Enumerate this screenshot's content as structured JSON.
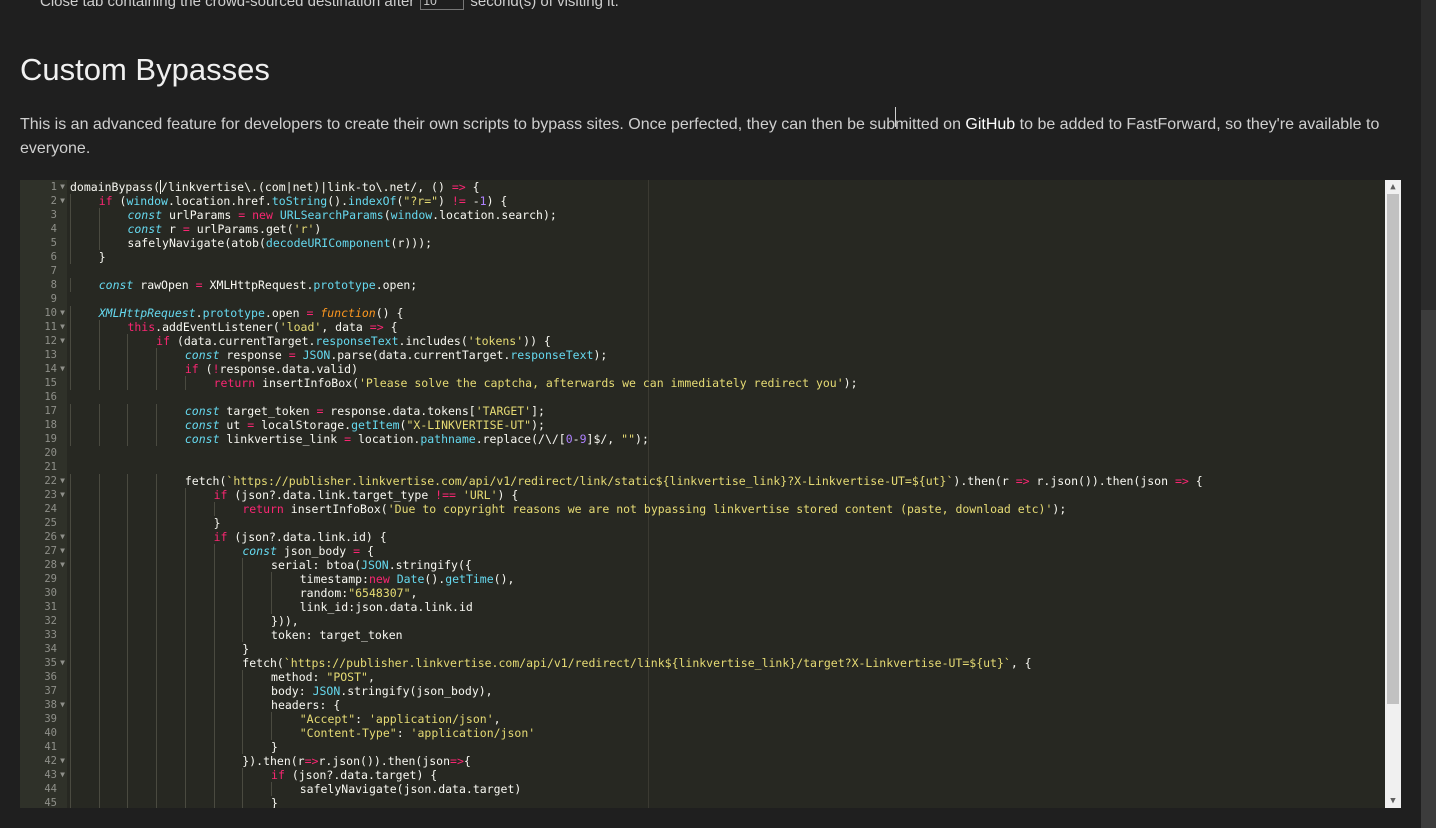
{
  "top_setting": {
    "prefix": "Close tab containing the crowd-sourced destination after",
    "value": "10",
    "suffix": "second(s) of visiting it."
  },
  "section": {
    "title": "Custom Bypasses",
    "desc_before": "This is an advanced feature for developers to create their own scripts to bypass sites. Once perfected, they can then be submitted on ",
    "link": "GitHub",
    "desc_after": " to be added to FastForward, so they're available to everyone."
  },
  "editor": {
    "line_numbers": [
      "1",
      "2",
      "3",
      "4",
      "5",
      "6",
      "7",
      "8",
      "9",
      "10",
      "11",
      "12",
      "13",
      "14",
      "15",
      "16",
      "17",
      "18",
      "19",
      "20",
      "21",
      "22",
      "23",
      "24",
      "25",
      "26",
      "27",
      "28",
      "29",
      "30",
      "31",
      "32",
      "33",
      "34",
      "35",
      "36",
      "37",
      "38",
      "39",
      "40",
      "41",
      "42",
      "43",
      "44",
      "45"
    ],
    "fold_lines": [
      1,
      2,
      10,
      11,
      12,
      14,
      22,
      23,
      26,
      27,
      28,
      35,
      38,
      42,
      43
    ],
    "code_lines": [
      "domainBypass(/linkvertise\\.(com|net)|link-to\\.net/, () => {",
      "    if (window.location.href.toString().indexOf(\"?r=\") != -1) {",
      "        const urlParams = new URLSearchParams(window.location.search);",
      "        const r = urlParams.get('r')",
      "        safelyNavigate(atob(decodeURIComponent(r)));",
      "    }",
      "",
      "    const rawOpen = XMLHttpRequest.prototype.open;",
      "",
      "    XMLHttpRequest.prototype.open = function() {",
      "        this.addEventListener('load', data => {",
      "            if (data.currentTarget.responseText.includes('tokens')) {",
      "                const response = JSON.parse(data.currentTarget.responseText);",
      "                if (!response.data.valid)",
      "                    return insertInfoBox('Please solve the captcha, afterwards we can immediately redirect you');",
      "",
      "                const target_token = response.data.tokens['TARGET'];",
      "                const ut = localStorage.getItem(\"X-LINKVERTISE-UT\");",
      "                const linkvertise_link = location.pathname.replace(/\\/[0-9]$/, \"\");",
      "",
      "",
      "                fetch(`https://publisher.linkvertise.com/api/v1/redirect/link/static${linkvertise_link}?X-Linkvertise-UT=${ut}`).then(r => r.json()).then(json => {",
      "                    if (json?.data.link.target_type !== 'URL') {",
      "                        return insertInfoBox('Due to copyright reasons we are not bypassing linkvertise stored content (paste, download etc)');",
      "                    }",
      "                    if (json?.data.link.id) {",
      "                        const json_body = {",
      "                            serial: btoa(JSON.stringify({",
      "                                timestamp:new Date().getTime(),",
      "                                random:\"6548307\",",
      "                                link_id:json.data.link.id",
      "                            })),",
      "                            token: target_token",
      "                        }",
      "                        fetch(`https://publisher.linkvertise.com/api/v1/redirect/link${linkvertise_link}/target?X-Linkvertise-UT=${ut}`, {",
      "                            method: \"POST\",",
      "                            body: JSON.stringify(json_body),",
      "                            headers: {",
      "                                \"Accept\": 'application/json',",
      "                                \"Content-Type\": 'application/json'",
      "                            }",
      "                        }).then(r=>r.json()).then(json=>{",
      "                            if (json?.data.target) {",
      "                                safelyNavigate(json.data.target)",
      "                            }"
    ]
  },
  "colors": {
    "page_bg": "#1f1f1f",
    "editor_bg": "#272822",
    "keyword": "#f92672",
    "string": "#e6db74",
    "builtin": "#66d9ef",
    "number": "#ae81ff"
  }
}
